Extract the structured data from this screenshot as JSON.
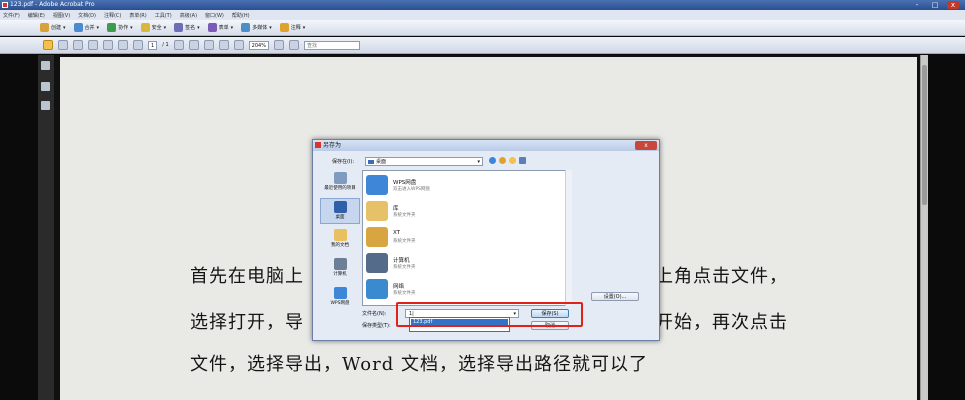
{
  "window": {
    "title": "123.pdf - Adobe Acrobat Pro",
    "controls": [
      "-",
      "□",
      "x"
    ]
  },
  "menubar": {
    "items": [
      "文件(F)",
      "编辑(E)",
      "视图(V)",
      "文档(D)",
      "注释(C)",
      "表单(R)",
      "工具(T)",
      "高级(A)",
      "窗口(W)",
      "帮助(H)"
    ]
  },
  "toolbar1": {
    "items": [
      {
        "label": "创建",
        "color": "#d8a13a"
      },
      {
        "label": "合并",
        "color": "#4d8bd0"
      },
      {
        "label": "协作",
        "color": "#3f9b4c"
      },
      {
        "label": "安全",
        "color": "#d9b63c"
      },
      {
        "label": "签名",
        "color": "#6b6fb5"
      },
      {
        "label": "表单",
        "color": "#7b5bb5"
      },
      {
        "label": "多媒体",
        "color": "#4a8fc8"
      },
      {
        "label": "注释",
        "color": "#e0a22f"
      }
    ]
  },
  "toolbar2": {
    "page_current": "1",
    "page_total": "/ 1",
    "zoom": "204%",
    "search_placeholder": "查找"
  },
  "document": {
    "lines": [
      "首先在电脑上",
      "上角点击文件，",
      "选择打开，导",
      "开始，再次点击",
      "文件，选择导出，Word 文档，选择导出路径就可以了"
    ]
  },
  "dialog": {
    "title": "另存为",
    "close": "x",
    "save_in_label": "保存在(I):",
    "save_in_value": "桌面",
    "places": [
      {
        "label": "最近使用的项目",
        "color": "#7f9bbf"
      },
      {
        "label": "桌面",
        "color": "#2f5fa8"
      },
      {
        "label": "我的文档",
        "color": "#e8c060"
      },
      {
        "label": "计算机",
        "color": "#6d7f96"
      },
      {
        "label": "WPS网盘",
        "color": "#3d86d8"
      }
    ],
    "files": [
      {
        "name": "WPS网盘",
        "sub": "双击进入WPS网盘",
        "color": "#3d86d8"
      },
      {
        "name": "库",
        "sub": "系统文件夹",
        "color": "#e6c167"
      },
      {
        "name": "XT",
        "sub": "系统文件夹",
        "color": "#d9a541"
      },
      {
        "name": "计算机",
        "sub": "系统文件夹",
        "color": "#546b8a"
      },
      {
        "name": "网络",
        "sub": "系统文件夹",
        "color": "#3a8ad0"
      }
    ],
    "options_button": "设置(O)...",
    "file_name_label": "文件名(N):",
    "file_name_value": "1|",
    "file_type_label": "保存类型(T):",
    "autocomplete_item": "123.pdf",
    "save_button": "保存(S)",
    "cancel_button": "取消",
    "highlight_color": "#e0221b"
  }
}
